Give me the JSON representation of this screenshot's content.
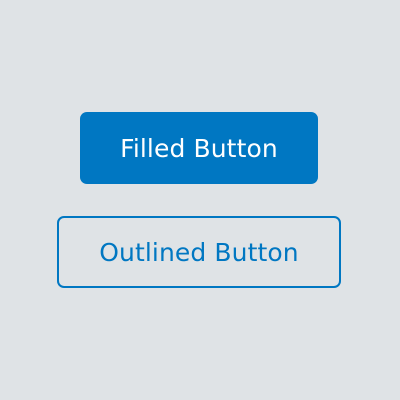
{
  "buttons": {
    "filled": {
      "label": "Filled Button",
      "background_color": "#0077c2",
      "text_color": "#ffffff"
    },
    "outlined": {
      "label": "Outlined Button",
      "border_color": "#0077c2",
      "text_color": "#0077c2"
    }
  },
  "page": {
    "background_color": "#dfe3e6"
  }
}
